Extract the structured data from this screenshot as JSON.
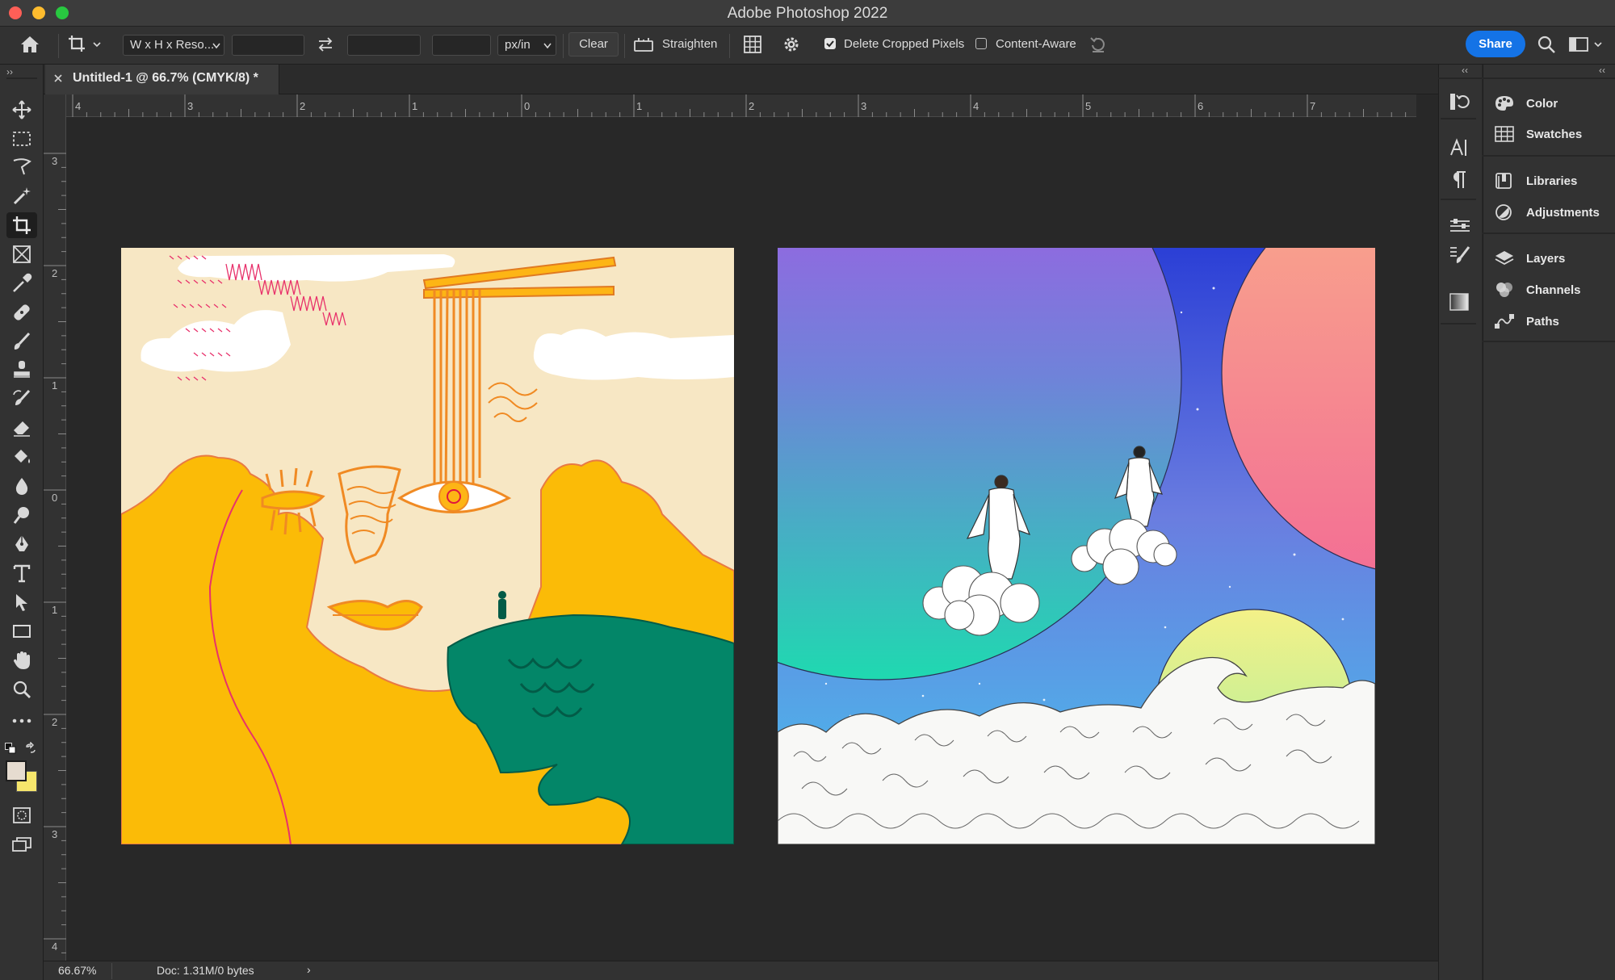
{
  "window": {
    "title": "Adobe Photoshop 2022"
  },
  "options_bar": {
    "ratio_preset": "W x H x Reso...",
    "width_value": "",
    "height_value": "",
    "resolution_value": "",
    "resolution_unit": "px/in",
    "clear_label": "Clear",
    "straighten_label": "Straighten",
    "delete_cropped_label": "Delete Cropped Pixels",
    "delete_cropped_checked": true,
    "content_aware_label": "Content-Aware",
    "content_aware_checked": false,
    "share_label": "Share"
  },
  "document_tab": {
    "title": "Untitled-1 @ 66.7% (CMYK/8) *"
  },
  "rulers": {
    "top_labels": [
      "4",
      "3",
      "2",
      "1",
      "0",
      "1",
      "2",
      "3",
      "4",
      "5",
      "6",
      "7"
    ],
    "left_labels": [
      "3",
      "2",
      "1",
      "0",
      "1",
      "2",
      "3",
      "4"
    ]
  },
  "status_bar": {
    "zoom": "66.67%",
    "doc_info": "Doc: 1.31M/0 bytes"
  },
  "tools": [
    "move-tool",
    "marquee-tool",
    "lasso-tool",
    "magic-wand-tool",
    "crop-tool",
    "frame-tool",
    "eyedropper-tool",
    "healing-brush-tool",
    "brush-tool",
    "clone-stamp-tool",
    "history-brush-tool",
    "eraser-tool",
    "paint-bucket-tool",
    "blur-tool",
    "dodge-tool",
    "pen-tool",
    "type-tool",
    "path-selection-tool",
    "rectangle-tool",
    "hand-tool",
    "zoom-tool",
    "more-tools"
  ],
  "colors": {
    "foreground": "#e6dcd0",
    "background": "#f6e66c",
    "accent": "#1473e6"
  },
  "panels": {
    "group1": [
      {
        "label": "Color",
        "icon": "color-palette-icon"
      },
      {
        "label": "Swatches",
        "icon": "swatches-grid-icon"
      }
    ],
    "group2": [
      {
        "label": "Libraries",
        "icon": "libraries-icon"
      },
      {
        "label": "Adjustments",
        "icon": "adjustments-icon"
      }
    ],
    "group3": [
      {
        "label": "Layers",
        "icon": "layers-icon"
      },
      {
        "label": "Channels",
        "icon": "channels-icon"
      },
      {
        "label": "Paths",
        "icon": "paths-icon"
      }
    ]
  }
}
